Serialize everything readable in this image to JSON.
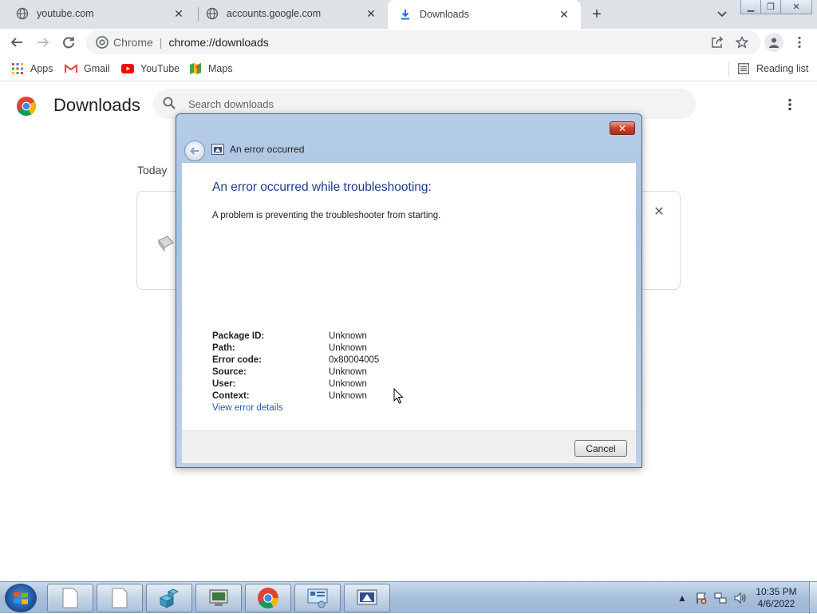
{
  "browser": {
    "tabs": [
      {
        "title": "youtube.com",
        "icon": "globe-icon",
        "active": false
      },
      {
        "title": "accounts.google.com",
        "icon": "globe-icon",
        "active": false
      },
      {
        "title": "Downloads",
        "icon": "download-icon",
        "active": true
      }
    ],
    "omnibox": {
      "scheme_label": "Chrome",
      "url": "chrome://downloads"
    },
    "bookmarks": [
      {
        "label": "Apps",
        "icon": "apps-grid-icon"
      },
      {
        "label": "Gmail",
        "icon": "gmail-icon"
      },
      {
        "label": "YouTube",
        "icon": "youtube-icon"
      },
      {
        "label": "Maps",
        "icon": "maps-icon"
      }
    ],
    "reading_list": "Reading list"
  },
  "downloads": {
    "title": "Downloads",
    "search_placeholder": "Search downloads",
    "section_label": "Today"
  },
  "dialog": {
    "window_title": "An error occurred",
    "heading": "An error occurred while troubleshooting:",
    "message": "A problem is preventing the troubleshooter from starting.",
    "properties": [
      {
        "label": "Package ID:",
        "value": "Unknown"
      },
      {
        "label": "Path:",
        "value": "Unknown"
      },
      {
        "label": "Error code:",
        "value": "0x80004005"
      },
      {
        "label": "Source:",
        "value": "Unknown"
      },
      {
        "label": "User:",
        "value": "Unknown"
      },
      {
        "label": "Context:",
        "value": "Unknown"
      }
    ],
    "details_link": "View error details",
    "cancel_label": "Cancel"
  },
  "taskbar": {
    "time": "10:35 PM",
    "date": "4/6/2022"
  },
  "colors": {
    "heading_blue": "#1e3c8b",
    "link_blue": "#2a5ea8",
    "chrome_tabstrip": "#dee1e6"
  }
}
